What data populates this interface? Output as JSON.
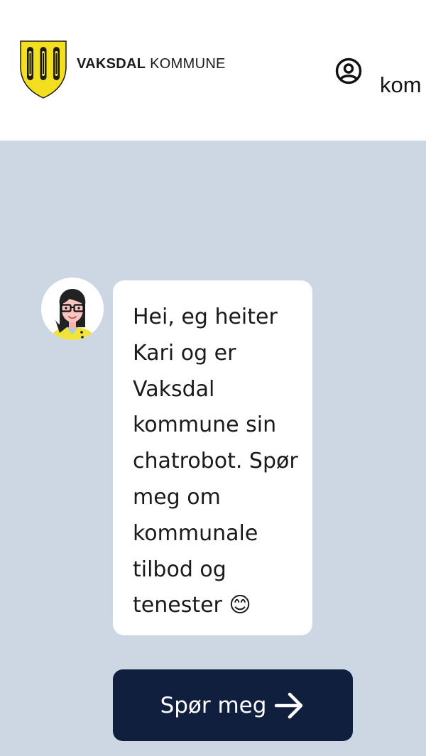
{
  "header": {
    "brand_strong": "VAKSDAL",
    "brand_light": "KOMMUNE",
    "user_label": "kom"
  },
  "chat": {
    "message": "Hei, eg heiter Kari og er Vaksdal kommune sin chatrobot. Spør meg om kommunale tilbod og tenester 😊",
    "cta_label": "Spør meg"
  },
  "colors": {
    "page_background": "#cdd7e3",
    "header_background": "#ffffff",
    "bubble_background": "#ffffff",
    "cta_background": "#0f1f3d",
    "crest_yellow": "#f4df1f",
    "avatar_shirt": "#f2e23a"
  },
  "icons": {
    "logo": "vaksdal-crest-icon",
    "user": "user-circle-icon",
    "avatar": "chatbot-avatar",
    "cta": "arrow-right-icon"
  }
}
